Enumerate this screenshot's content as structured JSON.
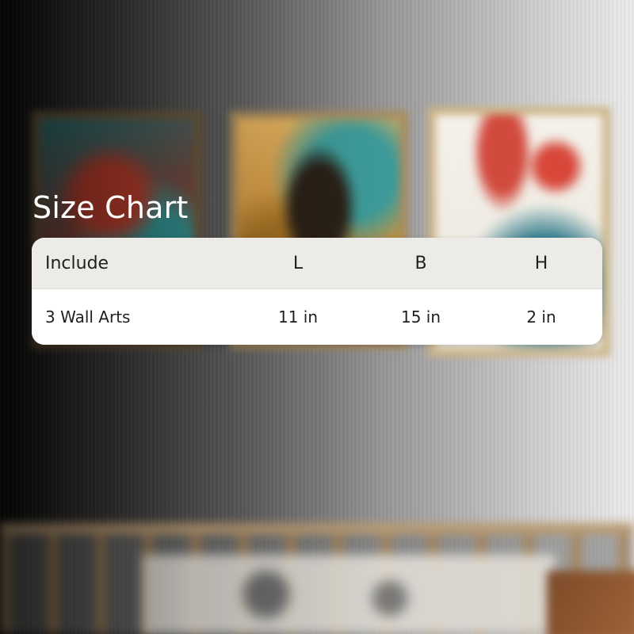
{
  "title": "Size Chart",
  "table": {
    "headers": [
      "Include",
      "L",
      "B",
      "H"
    ],
    "rows": [
      [
        "3 Wall Arts",
        "11 in",
        "15 in",
        "2 in"
      ]
    ]
  },
  "colors": {
    "card_header_bg": "#edebe8",
    "card_body_bg": "#ffffff",
    "title_text": "#ffffff",
    "table_text": "#1f1f1f"
  }
}
